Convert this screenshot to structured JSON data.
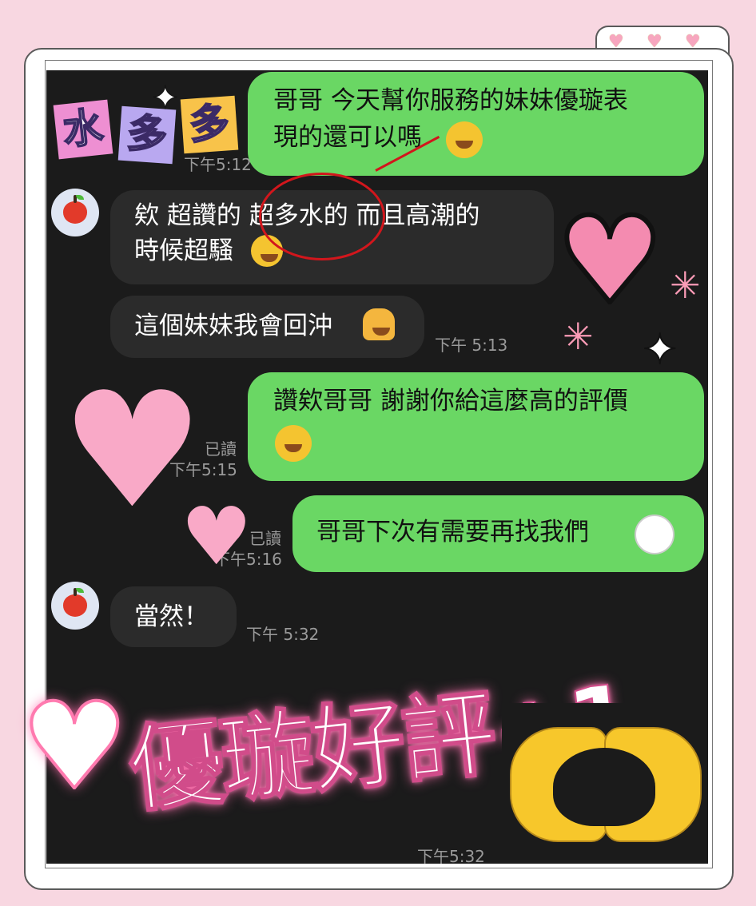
{
  "tab_hearts": [
    "♥",
    "♥",
    "♥"
  ],
  "stickers": {
    "tag_chars": [
      "水",
      "多",
      "多"
    ],
    "headline": "優璇好評+1"
  },
  "messages": [
    {
      "side": "right",
      "text_lines": [
        "哥哥 今天幫你服務的妹妹優璇表",
        "現的還可以嗎"
      ],
      "emoji": "crying-face",
      "time": "下午5:12"
    },
    {
      "side": "left",
      "text_lines": [
        "欸 超讚的 超多水的 而且高潮的",
        "時候超騷"
      ],
      "emoji": "laughing-face"
    },
    {
      "side": "left",
      "text_lines": [
        "這個妹妹我會回沖"
      ],
      "emoji": "thumbs-up",
      "time": "下午 5:13"
    },
    {
      "side": "right",
      "text_lines": [
        "讚欸哥哥 謝謝你給這麼高的評價"
      ],
      "emoji": "crying-face",
      "read": "已讀",
      "time": "下午5:15"
    },
    {
      "side": "right",
      "text_lines": [
        "哥哥下次有需要再找我們"
      ],
      "emoji": "pleading-face",
      "read": "已讀",
      "time": "下午5:16"
    },
    {
      "side": "left",
      "text_lines": [
        "當然！"
      ],
      "time": "下午 5:32"
    }
  ],
  "last_time": "下午5:32",
  "colors": {
    "bubble_green": "#6ad764",
    "bubble_grey": "#2b2b2b",
    "background": "#1b1b1b",
    "annotation_red": "#d2161c"
  }
}
